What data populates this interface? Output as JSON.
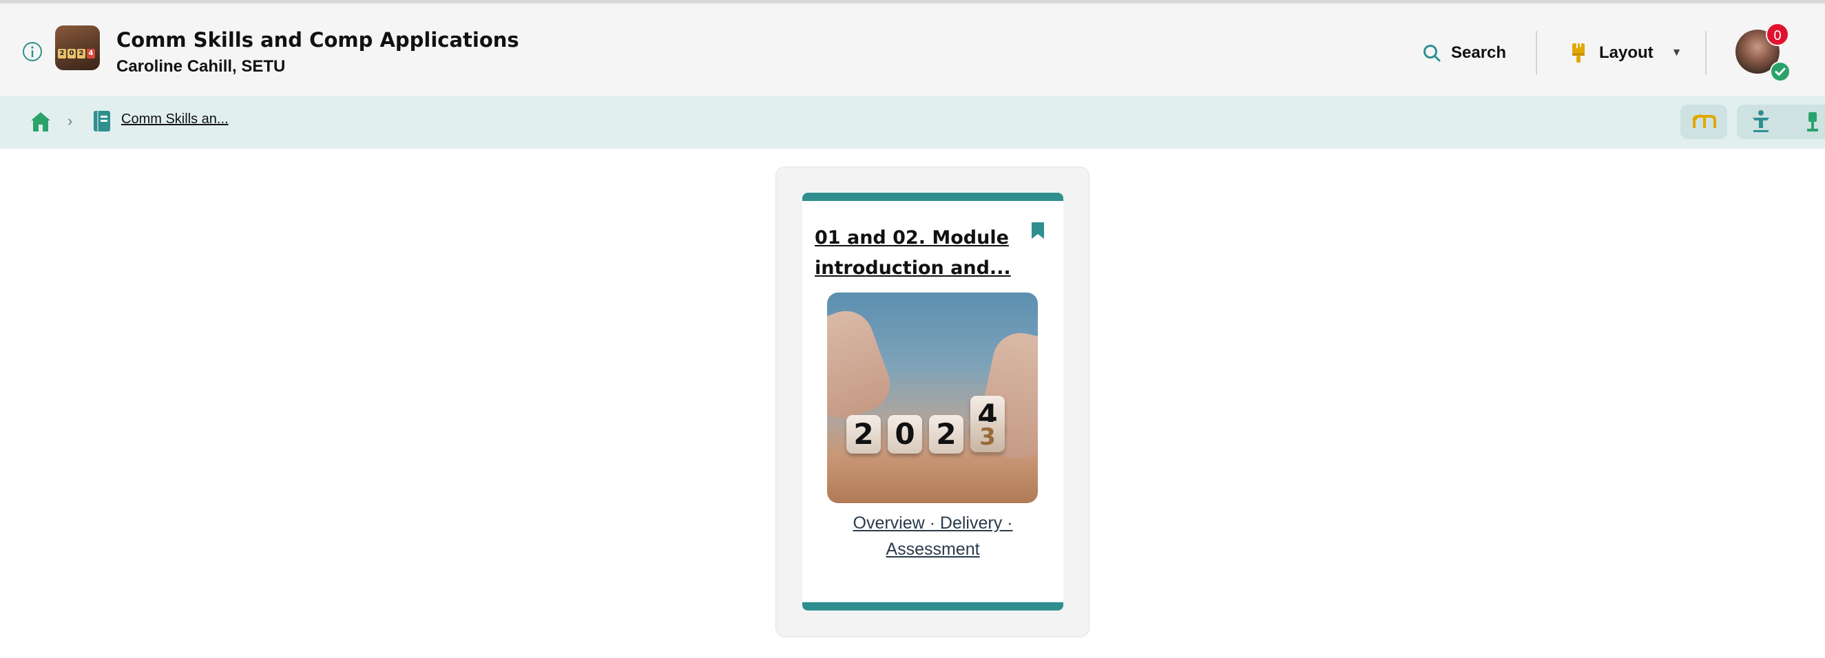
{
  "header": {
    "course_title": "Comm Skills and Comp Applications",
    "course_subtitle": "Caroline Cahill, SETU",
    "search_label": "Search",
    "layout_label": "Layout",
    "notification_count": "0",
    "logo_digits": [
      "2",
      "0",
      "2",
      "4"
    ]
  },
  "breadcrumb": {
    "course_link": "Comm Skills an..."
  },
  "card": {
    "title": "01 and 02. Module introduction and...",
    "description": "Overview · Delivery · Assessment",
    "image_digits": [
      "2",
      "0",
      "2",
      "4",
      "3"
    ]
  },
  "colors": {
    "teal": "#2f8f8f",
    "home_green": "#2aa36b",
    "badge_red": "#e0122d",
    "nav_bg": "#e2efef",
    "layout_icon": "#e0a800"
  }
}
